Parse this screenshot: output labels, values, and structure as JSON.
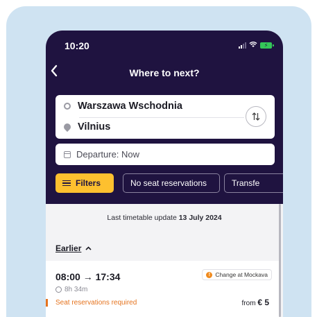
{
  "status_bar": {
    "time": "10:20"
  },
  "header": {
    "title": "Where to next?"
  },
  "route": {
    "from": "Warszawa Wschodnia",
    "to": "Vilnius"
  },
  "departure": {
    "label": "Departure: Now"
  },
  "filters": {
    "filters_label": "Filters",
    "chips": [
      "No seat reservations",
      "Transfe"
    ]
  },
  "timetable": {
    "update_prefix": "Last timetable update",
    "update_date": "13 July 2024"
  },
  "earlier": {
    "label": "Earlier"
  },
  "trip": {
    "departure_time": "08:00",
    "arrival_time": "17:34",
    "arrow": "→",
    "duration": "8h 34m",
    "change_label": "Change at Mockava",
    "seat_notice": "Seat reservations required",
    "price_prefix": "from",
    "price": "€ 5"
  },
  "colors": {
    "header_bg": "#1f1340",
    "accent_yellow": "#fdc02f",
    "warning_orange": "#e5731e",
    "card_bg": "#cfe3f2"
  },
  "icons": [
    "back-icon",
    "origin-dot-icon",
    "location-pin-icon",
    "swap-icon",
    "calendar-icon",
    "filter-icon",
    "chevron-up-icon",
    "clock-icon",
    "info-icon",
    "wifi-icon",
    "battery-icon",
    "signal-icon"
  ]
}
